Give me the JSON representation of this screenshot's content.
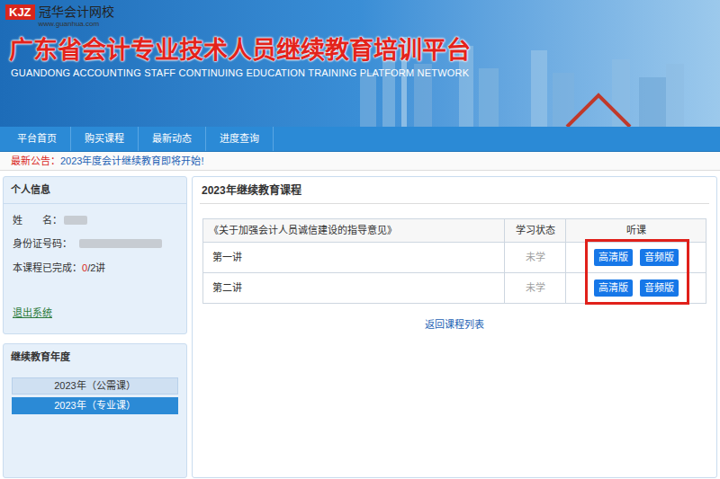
{
  "header": {
    "logo_mark": "KJZ",
    "logo_name": "冠华会计网校",
    "logo_url": "www.guanhua.com",
    "title": "广东省会计专业技术人员继续教育培训平台",
    "subtitle": "GUANDONG ACCOUNTING STAFF CONTINUING EDUCATION TRAINING PLATFORM NETWORK"
  },
  "nav": [
    {
      "label": "平台首页"
    },
    {
      "label": "购买课程"
    },
    {
      "label": "最新动态"
    },
    {
      "label": "进度查询"
    }
  ],
  "notice": {
    "label": "最新公告：",
    "text": "2023年度会计继续教育即将开始!"
  },
  "personal_info": {
    "title": "个人信息",
    "fields": [
      {
        "label": "姓　　名：",
        "blurred": true
      },
      {
        "label": "身份证号码：",
        "blurred": true
      }
    ],
    "progress": {
      "label": "本课程已完成：",
      "done": "0",
      "total": "/2讲"
    },
    "logout": "退出系统"
  },
  "years": {
    "title": "继续教育年度",
    "items": [
      {
        "label": "2023年（公需课）",
        "selected": false
      },
      {
        "label": "2023年（专业课）",
        "selected": true
      }
    ]
  },
  "course": {
    "title": "2023年继续教育课程",
    "table": {
      "columns": [
        "《关于加强会计人员诚信建设的指导意见》",
        "学习状态",
        "听课"
      ],
      "rows": [
        {
          "name": "第一讲",
          "status": "未学",
          "buttons": [
            "高清版",
            "音频版"
          ]
        },
        {
          "name": "第二讲",
          "status": "未学",
          "buttons": [
            "高清版",
            "音频版"
          ]
        }
      ],
      "highlighted": true
    },
    "back_link": "返回课程列表"
  }
}
